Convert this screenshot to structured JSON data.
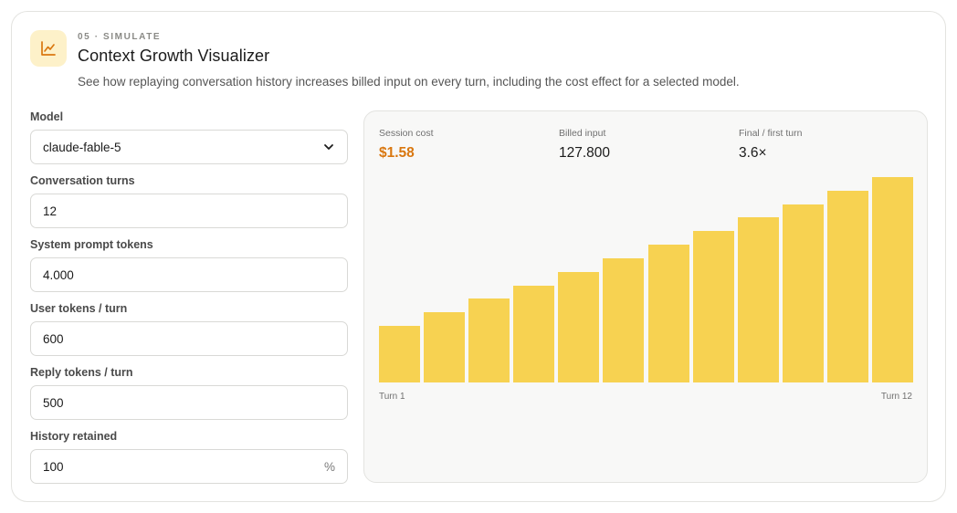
{
  "header": {
    "icon": "line-chart-icon",
    "eyebrow": "05 · SIMULATE",
    "title": "Context Growth Visualizer",
    "subtitle": "See how replaying conversation history increases billed input on every turn, including the cost effect for a selected model."
  },
  "form": {
    "model": {
      "label": "Model",
      "value": "claude-fable-5"
    },
    "turns": {
      "label": "Conversation turns",
      "value": "12"
    },
    "system_tokens": {
      "label": "System prompt tokens",
      "value": "4.000"
    },
    "user_tokens": {
      "label": "User tokens / turn",
      "value": "600"
    },
    "reply_tokens": {
      "label": "Reply tokens / turn",
      "value": "500"
    },
    "history": {
      "label": "History retained",
      "value": "100",
      "unit": "%"
    }
  },
  "stats": {
    "session_cost": {
      "label": "Session cost",
      "value": "$1.58"
    },
    "billed_input": {
      "label": "Billed input",
      "value": "127.800"
    },
    "ratio": {
      "label": "Final / first turn",
      "value": "3.6×"
    }
  },
  "chart_data": {
    "type": "bar",
    "categories": [
      "Turn 1",
      "Turn 2",
      "Turn 3",
      "Turn 4",
      "Turn 5",
      "Turn 6",
      "Turn 7",
      "Turn 8",
      "Turn 9",
      "Turn 10",
      "Turn 11",
      "Turn 12"
    ],
    "values": [
      4600,
      5700,
      6800,
      7900,
      9000,
      10100,
      11200,
      12300,
      13400,
      14500,
      15600,
      16700
    ],
    "ylim": [
      0,
      16700
    ],
    "x_start_label": "Turn 1",
    "x_end_label": "Turn 12",
    "bar_color": "#f7d251"
  },
  "colors": {
    "accent": "#d9770f",
    "badge_bg": "#fdf1c9",
    "bar": "#f7d251"
  }
}
